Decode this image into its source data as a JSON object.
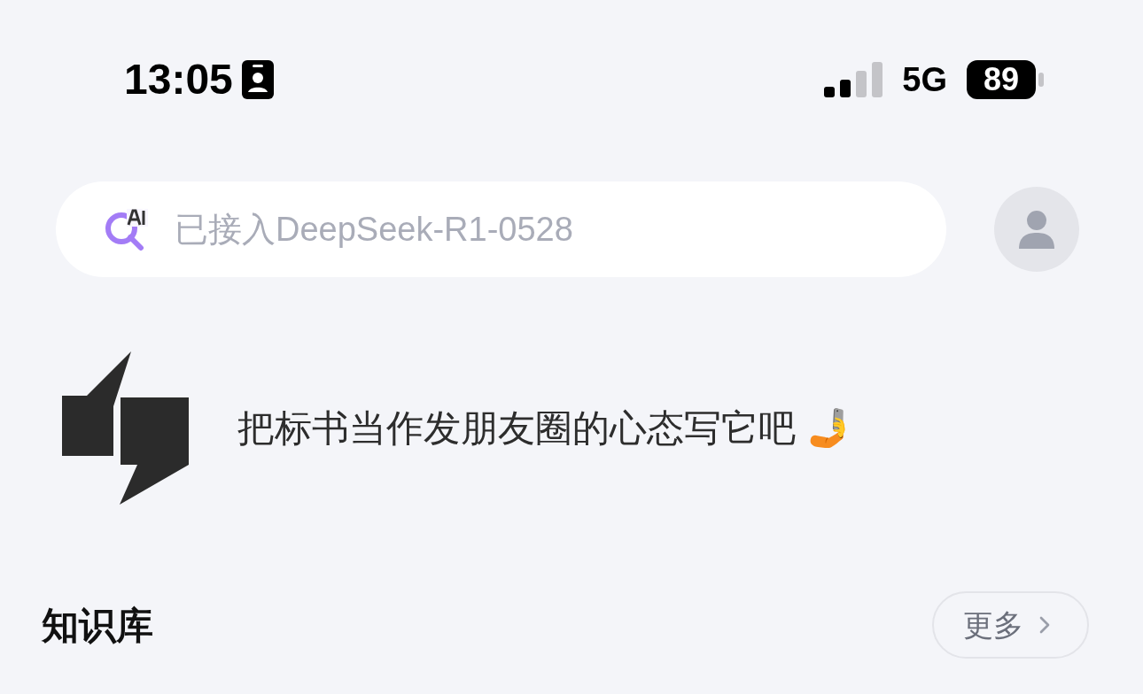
{
  "status_bar": {
    "time": "13:05",
    "network": "5G",
    "battery": "89"
  },
  "search": {
    "placeholder": "已接入DeepSeek-R1-0528"
  },
  "slogan": {
    "text": "把标书当作发朋友圈的心态写它吧 🤳"
  },
  "knowledge_base": {
    "title": "知识库",
    "more_button": "更多"
  }
}
